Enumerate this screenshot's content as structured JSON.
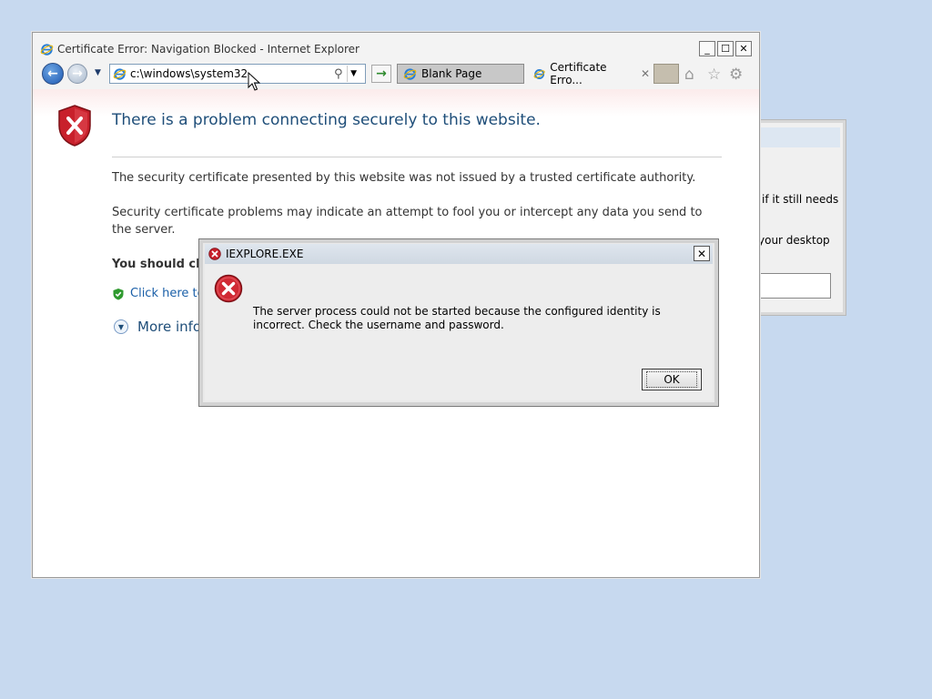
{
  "background_window": {
    "text_line1": "if it still needs",
    "text_line2": "your desktop"
  },
  "browser": {
    "window_title": "Certificate Error: Navigation Blocked - Internet Explorer",
    "window_buttons": {
      "minimize": "_",
      "maximize": "☐",
      "close": "✕"
    },
    "address": {
      "value": "c:\\windows\\system32"
    },
    "tabs": [
      {
        "label": "Blank Page"
      },
      {
        "label": "Certificate Erro..."
      }
    ],
    "tab_close": "✕"
  },
  "page": {
    "heading": "There is a problem connecting securely to this website.",
    "paragraph1": "The security certificate presented by this website was not issued by a trusted certificate authority.",
    "paragraph2": "Security certificate problems may indicate an attempt to fool you or intercept any data you send to the server.",
    "recommendation": "You should close this webpage and do not continue to this website.",
    "link_close": "Click here to close this webpage.",
    "more_info": "More information"
  },
  "dialog": {
    "title": "IEXPLORE.EXE",
    "close": "✕",
    "message": "The server process could not be started because the configured identity is incorrect. Check the username and password.",
    "ok_label": "OK"
  },
  "colors": {
    "desktop": "#c7d9ef",
    "error_red": "#c8202b",
    "link_blue": "#1a5fa8"
  }
}
